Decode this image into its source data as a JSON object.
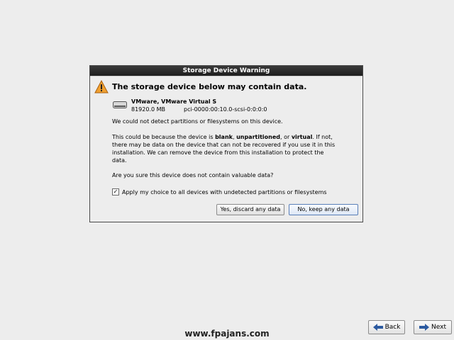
{
  "dialog": {
    "title": "Storage Device Warning",
    "headline": "The storage device below may contain data.",
    "device": {
      "name": "VMware, VMware Virtual S",
      "size": "81920.0 MB",
      "path": "pci-0000:00:10.0-scsi-0:0:0:0",
      "icon": "hard-disk-icon"
    },
    "para1": "We could not detect partitions or filesystems on this device.",
    "para2": {
      "t1": "This could be because the device is ",
      "b1": "blank",
      "t2": ", ",
      "b2": "unpartitioned",
      "t3": ", or ",
      "b3": "virtual",
      "t4": ". If not, there may be data on the device that can not be recovered if you use it in this installation. We can remove the device from this installation to protect the data."
    },
    "para3": "Are you sure this device does not contain valuable data?",
    "checkbox": {
      "checked": true,
      "label": "Apply my choice to all devices with undetected partitions or filesystems"
    },
    "btn_yes": "Yes, discard any data",
    "btn_no": "No, keep any data"
  },
  "nav": {
    "back_label": "Back",
    "next_label": "Next"
  },
  "footer": {
    "url": "www.fpajans.com"
  },
  "colors": {
    "titlebar": "#2a2a2a",
    "warning": "#f0a030",
    "background": "#ededed"
  }
}
